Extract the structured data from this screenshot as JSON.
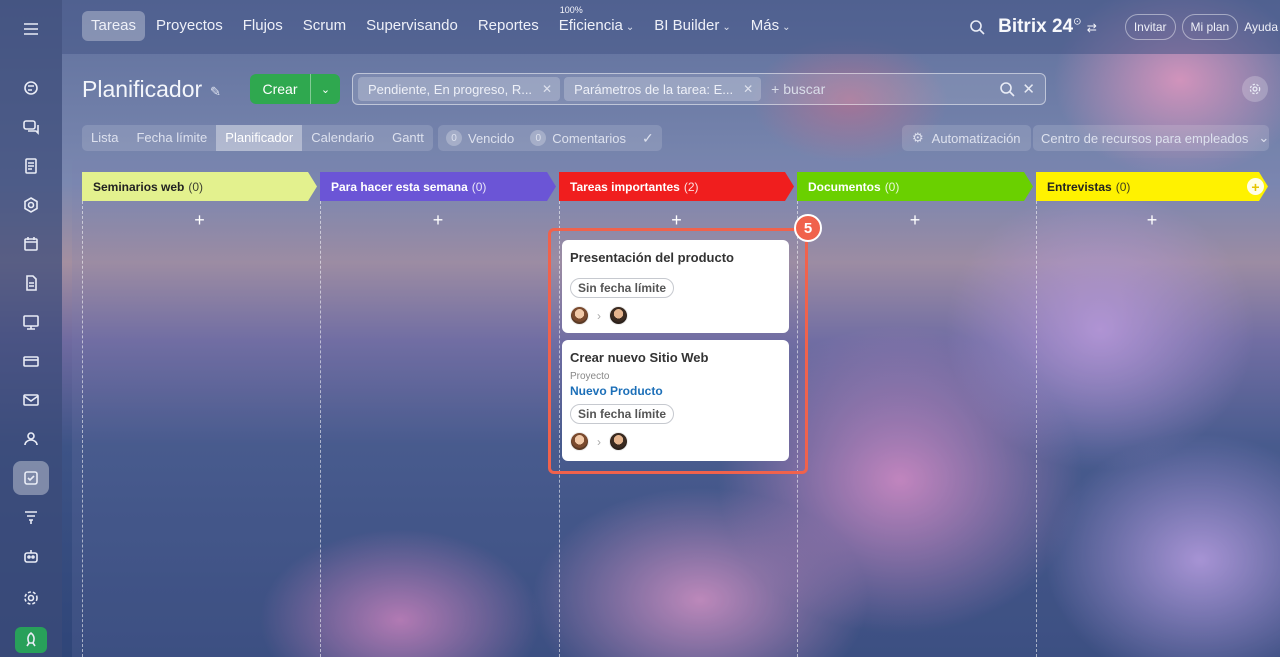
{
  "topnav": {
    "items": [
      {
        "label": "Tareas",
        "active": true
      },
      {
        "label": "Proyectos"
      },
      {
        "label": "Flujos"
      },
      {
        "label": "Scrum"
      },
      {
        "label": "Supervisando"
      },
      {
        "label": "Reportes"
      },
      {
        "label": "Eficiencia",
        "sup": "100%",
        "dropdown": true
      },
      {
        "label": "BI Builder",
        "dropdown": true
      },
      {
        "label": "Más",
        "dropdown": true
      }
    ],
    "brand": "Bitrix 24",
    "invite": "Invitar",
    "plan": "Mi plan",
    "help": "Ayuda"
  },
  "header": {
    "title": "Planificador",
    "create_label": "Crear",
    "filter_chips": [
      "Pendiente, En progreso, R...",
      "Parámetros de la tarea: E..."
    ],
    "search_placeholder": "+ buscar"
  },
  "viewtabs": {
    "items": [
      "Lista",
      "Fecha límite",
      "Planificador",
      "Calendario",
      "Gantt"
    ],
    "active": "Planificador",
    "overdue_count": "0",
    "overdue_label": "Vencido",
    "comments_count": "0",
    "comments_label": "Comentarios",
    "automation_label": "Automatización",
    "resources_label": "Centro de recursos para empleados"
  },
  "columns": [
    {
      "title": "Seminarios web",
      "count": "(0)",
      "color": "#e3f18e"
    },
    {
      "title": "Para hacer esta semana",
      "count": "(0)",
      "color": "#6b55d6"
    },
    {
      "title": "Tareas importantes",
      "count": "(2)",
      "color": "#f01e1e"
    },
    {
      "title": "Documentos",
      "count": "(0)",
      "color": "#6ad000"
    },
    {
      "title": "Entrevistas",
      "count": "(0)",
      "color": "#fff200"
    }
  ],
  "cards": [
    {
      "title": "Presentación del producto",
      "deadline": "Sin fecha límite"
    },
    {
      "title": "Crear nuevo Sitio Web",
      "project_label": "Proyecto",
      "project_name": "Nuevo Producto",
      "deadline": "Sin fecha límite"
    }
  ],
  "step_badge": "5",
  "colors": {
    "create": "#2fa84f",
    "highlight": "#f0624c",
    "link": "#1c6fb8"
  }
}
